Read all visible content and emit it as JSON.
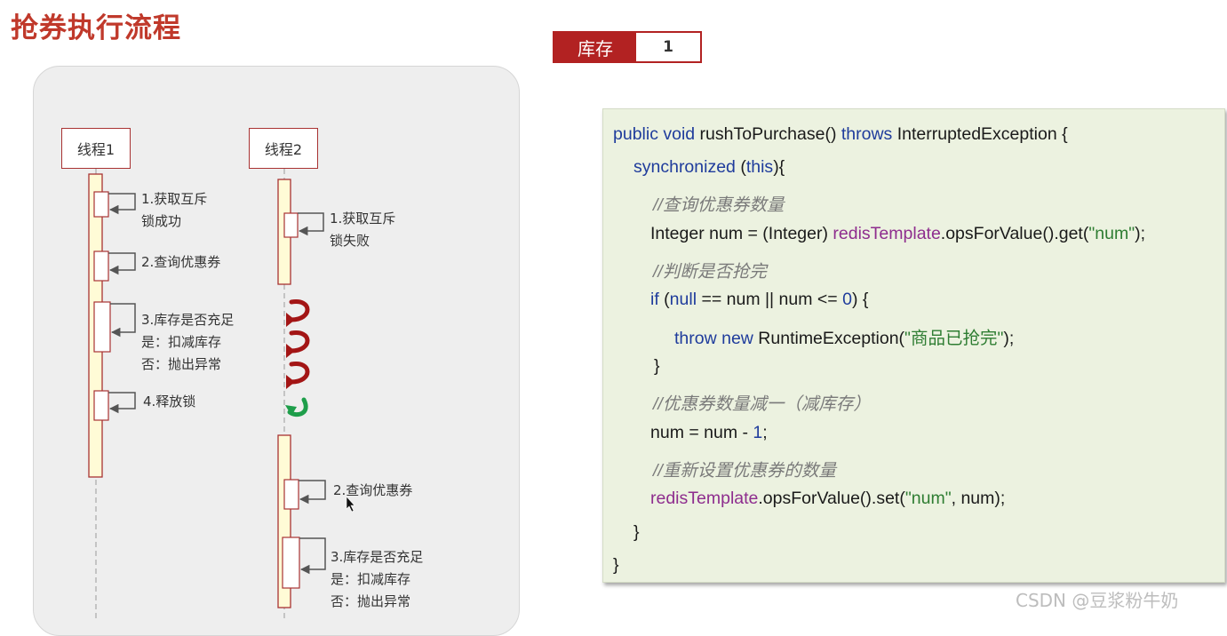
{
  "title": "抢券执行流程",
  "stock": {
    "label": "库存",
    "value": "1"
  },
  "threads": [
    {
      "label": "线程1"
    },
    {
      "label": "线程2"
    }
  ],
  "thread1_steps": [
    {
      "lines": [
        "1.获取互斥",
        "锁成功"
      ]
    },
    {
      "lines": [
        "2.查询优惠券"
      ]
    },
    {
      "lines": [
        "3.库存是否充足",
        "是：扣减库存",
        "否：抛出异常"
      ]
    },
    {
      "lines": [
        "4.释放锁"
      ]
    }
  ],
  "thread2_steps": [
    {
      "lines": [
        "1.获取互斥",
        "锁失败"
      ]
    },
    {
      "lines": [
        "2.查询优惠券"
      ]
    },
    {
      "lines": [
        "3.库存是否充足",
        "是：扣减库存",
        "否：抛出异常"
      ]
    }
  ],
  "retry_arrows": {
    "red_count": 3,
    "green_count": 1,
    "red_color": "#a31515",
    "green_color": "#1e9e4a"
  },
  "code": {
    "l1_kw1": "public void",
    "l1_name": " rushToPurchase() ",
    "l1_kw2": "throws",
    "l1_rest": " InterruptedException {",
    "l2_kw": "synchronized",
    "l2_open": " (",
    "l2_this": "this",
    "l2_close": "){",
    "l3_comment": "//查询优惠券数量",
    "l4_pre": "Integer num = (Integer) ",
    "l4_field": "redisTemplate",
    "l4_mid": ".opsForValue().get(",
    "l4_str": "\"num\"",
    "l4_end": ");",
    "l5_comment": "//判断是否抢完",
    "l6_if": "if",
    "l6_open": " (",
    "l6_null": "null",
    "l6_mid": " == num || num <= ",
    "l6_zero": "0",
    "l6_end": ") {",
    "l7_kw": "throw new",
    "l7_mid": " RuntimeException(",
    "l7_str": "\"商品已抢完\"",
    "l7_end": ");",
    "l8": "}",
    "l9_comment": "//优惠券数量减一（减库存）",
    "l10_pre": "num = num - ",
    "l10_num": "1",
    "l10_end": ";",
    "l11_comment": "//重新设置优惠券的数量",
    "l12_field": "redisTemplate",
    "l12_mid": ".opsForValue().set(",
    "l12_str": "\"num\"",
    "l12_end": ", num);",
    "l13": "}",
    "l14": "}"
  },
  "watermark": "CSDN @豆浆粉牛奶"
}
